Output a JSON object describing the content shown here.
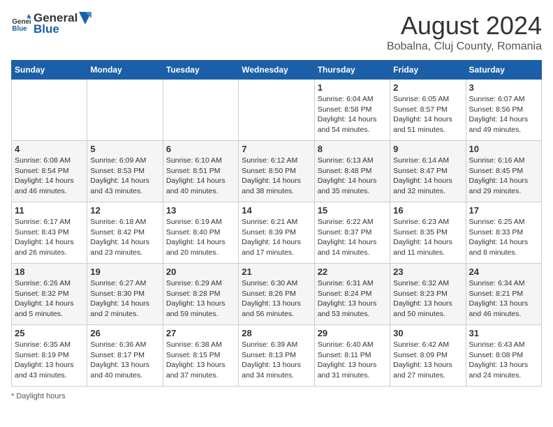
{
  "header": {
    "logo_general": "General",
    "logo_blue": "Blue",
    "main_title": "August 2024",
    "subtitle": "Bobalna, Cluj County, Romania"
  },
  "calendar": {
    "weekdays": [
      "Sunday",
      "Monday",
      "Tuesday",
      "Wednesday",
      "Thursday",
      "Friday",
      "Saturday"
    ],
    "weeks": [
      [
        {
          "day": "",
          "info": ""
        },
        {
          "day": "",
          "info": ""
        },
        {
          "day": "",
          "info": ""
        },
        {
          "day": "",
          "info": ""
        },
        {
          "day": "1",
          "info": "Sunrise: 6:04 AM\nSunset: 8:58 PM\nDaylight: 14 hours and 54 minutes."
        },
        {
          "day": "2",
          "info": "Sunrise: 6:05 AM\nSunset: 8:57 PM\nDaylight: 14 hours and 51 minutes."
        },
        {
          "day": "3",
          "info": "Sunrise: 6:07 AM\nSunset: 8:56 PM\nDaylight: 14 hours and 49 minutes."
        }
      ],
      [
        {
          "day": "4",
          "info": "Sunrise: 6:08 AM\nSunset: 8:54 PM\nDaylight: 14 hours and 46 minutes."
        },
        {
          "day": "5",
          "info": "Sunrise: 6:09 AM\nSunset: 8:53 PM\nDaylight: 14 hours and 43 minutes."
        },
        {
          "day": "6",
          "info": "Sunrise: 6:10 AM\nSunset: 8:51 PM\nDaylight: 14 hours and 40 minutes."
        },
        {
          "day": "7",
          "info": "Sunrise: 6:12 AM\nSunset: 8:50 PM\nDaylight: 14 hours and 38 minutes."
        },
        {
          "day": "8",
          "info": "Sunrise: 6:13 AM\nSunset: 8:48 PM\nDaylight: 14 hours and 35 minutes."
        },
        {
          "day": "9",
          "info": "Sunrise: 6:14 AM\nSunset: 8:47 PM\nDaylight: 14 hours and 32 minutes."
        },
        {
          "day": "10",
          "info": "Sunrise: 6:16 AM\nSunset: 8:45 PM\nDaylight: 14 hours and 29 minutes."
        }
      ],
      [
        {
          "day": "11",
          "info": "Sunrise: 6:17 AM\nSunset: 8:43 PM\nDaylight: 14 hours and 26 minutes."
        },
        {
          "day": "12",
          "info": "Sunrise: 6:18 AM\nSunset: 8:42 PM\nDaylight: 14 hours and 23 minutes."
        },
        {
          "day": "13",
          "info": "Sunrise: 6:19 AM\nSunset: 8:40 PM\nDaylight: 14 hours and 20 minutes."
        },
        {
          "day": "14",
          "info": "Sunrise: 6:21 AM\nSunset: 8:39 PM\nDaylight: 14 hours and 17 minutes."
        },
        {
          "day": "15",
          "info": "Sunrise: 6:22 AM\nSunset: 8:37 PM\nDaylight: 14 hours and 14 minutes."
        },
        {
          "day": "16",
          "info": "Sunrise: 6:23 AM\nSunset: 8:35 PM\nDaylight: 14 hours and 11 minutes."
        },
        {
          "day": "17",
          "info": "Sunrise: 6:25 AM\nSunset: 8:33 PM\nDaylight: 14 hours and 8 minutes."
        }
      ],
      [
        {
          "day": "18",
          "info": "Sunrise: 6:26 AM\nSunset: 8:32 PM\nDaylight: 14 hours and 5 minutes."
        },
        {
          "day": "19",
          "info": "Sunrise: 6:27 AM\nSunset: 8:30 PM\nDaylight: 14 hours and 2 minutes."
        },
        {
          "day": "20",
          "info": "Sunrise: 6:29 AM\nSunset: 8:28 PM\nDaylight: 13 hours and 59 minutes."
        },
        {
          "day": "21",
          "info": "Sunrise: 6:30 AM\nSunset: 8:26 PM\nDaylight: 13 hours and 56 minutes."
        },
        {
          "day": "22",
          "info": "Sunrise: 6:31 AM\nSunset: 8:24 PM\nDaylight: 13 hours and 53 minutes."
        },
        {
          "day": "23",
          "info": "Sunrise: 6:32 AM\nSunset: 8:23 PM\nDaylight: 13 hours and 50 minutes."
        },
        {
          "day": "24",
          "info": "Sunrise: 6:34 AM\nSunset: 8:21 PM\nDaylight: 13 hours and 46 minutes."
        }
      ],
      [
        {
          "day": "25",
          "info": "Sunrise: 6:35 AM\nSunset: 8:19 PM\nDaylight: 13 hours and 43 minutes."
        },
        {
          "day": "26",
          "info": "Sunrise: 6:36 AM\nSunset: 8:17 PM\nDaylight: 13 hours and 40 minutes."
        },
        {
          "day": "27",
          "info": "Sunrise: 6:38 AM\nSunset: 8:15 PM\nDaylight: 13 hours and 37 minutes."
        },
        {
          "day": "28",
          "info": "Sunrise: 6:39 AM\nSunset: 8:13 PM\nDaylight: 13 hours and 34 minutes."
        },
        {
          "day": "29",
          "info": "Sunrise: 6:40 AM\nSunset: 8:11 PM\nDaylight: 13 hours and 31 minutes."
        },
        {
          "day": "30",
          "info": "Sunrise: 6:42 AM\nSunset: 8:09 PM\nDaylight: 13 hours and 27 minutes."
        },
        {
          "day": "31",
          "info": "Sunrise: 6:43 AM\nSunset: 8:08 PM\nDaylight: 13 hours and 24 minutes."
        }
      ]
    ]
  },
  "footer": {
    "note": "Daylight hours"
  }
}
